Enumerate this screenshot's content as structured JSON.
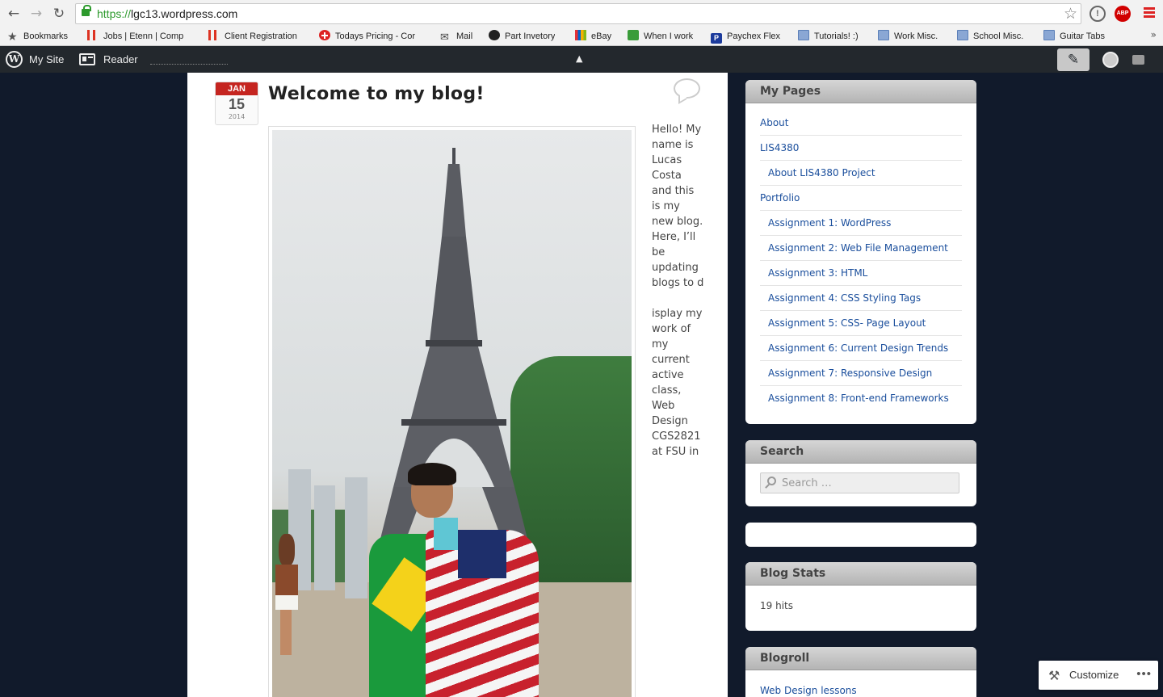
{
  "browser": {
    "url_scheme": "https://",
    "url_host": "lgc13.wordpress.com",
    "ext_abp": "ABP",
    "bookmarks": [
      {
        "label": "Bookmarks",
        "icon": "star-icon"
      },
      {
        "label": "Jobs | Etenn | Comp",
        "icon": "bars-icon"
      },
      {
        "label": "Client Registration",
        "icon": "bars-icon"
      },
      {
        "label": "Todays Pricing - Cor",
        "icon": "red-cross-icon"
      },
      {
        "label": "Mail",
        "icon": "mail-icon"
      },
      {
        "label": "Part Invetory",
        "icon": "part-icon"
      },
      {
        "label": "eBay",
        "icon": "ebay-icon"
      },
      {
        "label": "When I work",
        "icon": "green-list-icon"
      },
      {
        "label": "Paychex Flex",
        "icon": "paychex-icon"
      },
      {
        "label": "Tutorials! :)",
        "icon": "folder-icon"
      },
      {
        "label": "Work Misc.",
        "icon": "folder-icon"
      },
      {
        "label": "School Misc.",
        "icon": "folder-icon"
      },
      {
        "label": "Guitar Tabs",
        "icon": "folder-icon"
      }
    ],
    "more_label": "»"
  },
  "adminbar": {
    "my_site": "My Site",
    "reader": "Reader"
  },
  "post": {
    "month": "JAN",
    "day": "15",
    "year": "2014",
    "title": "Welcome to my blog!",
    "paragraph1": "Hello! My name is Lucas Costa and this is my new blog. Here, I’ll be updating blogs to d",
    "paragraph2": "isplay my work of my current active class, Web Design CGS2821 at FSU in"
  },
  "sidebar": {
    "pages_title": "My Pages",
    "pages": [
      {
        "label": "About",
        "sub": false
      },
      {
        "label": "LIS4380",
        "sub": false
      },
      {
        "label": "About LIS4380 Project",
        "sub": true
      },
      {
        "label": "Portfolio",
        "sub": false
      },
      {
        "label": "Assignment 1: WordPress",
        "sub": true
      },
      {
        "label": "Assignment 2: Web File Management",
        "sub": true
      },
      {
        "label": "Assignment 3: HTML",
        "sub": true
      },
      {
        "label": "Assignment 4: CSS Styling Tags",
        "sub": true
      },
      {
        "label": "Assignment 5: CSS- Page Layout",
        "sub": true
      },
      {
        "label": "Assignment 6: Current Design Trends",
        "sub": true
      },
      {
        "label": "Assignment 7: Responsive Design",
        "sub": true
      },
      {
        "label": "Assignment 8: Front-end Frameworks",
        "sub": true
      }
    ],
    "search_title": "Search",
    "search_placeholder": "Search …",
    "stats_title": "Blog Stats",
    "stats_value": "19 hits",
    "blogroll_title": "Blogroll",
    "blogroll_first": "Web Design lessons"
  },
  "customize": {
    "label": "Customize"
  },
  "colors": {
    "page_bg": "#111a2b",
    "admin_bar": "#23282d",
    "link": "#1a4e9c",
    "date_red": "#c52520"
  }
}
